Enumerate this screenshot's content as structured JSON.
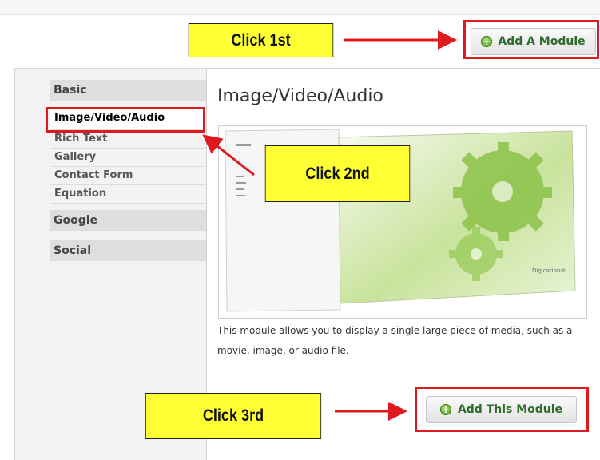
{
  "callouts": {
    "first": "Click 1st",
    "second": "Click 2nd",
    "third": "Click 3rd"
  },
  "header": {
    "add_module_label": "Add A Module",
    "add_module_icon": "plus-circle-icon"
  },
  "sidebar": {
    "categories": [
      {
        "label": "Basic",
        "items": [
          "Image/Video/Audio",
          "Rich Text",
          "Gallery",
          "Contact Form",
          "Equation"
        ]
      },
      {
        "label": "Google"
      },
      {
        "label": "Social"
      }
    ],
    "selected": "Image/Video/Audio"
  },
  "module": {
    "title": "Image/Video/Audio",
    "description": "This module allows you to display a single large piece of media, such as a movie, image, or audio file.",
    "preview_caption": "Digication®",
    "add_label": "Add This Module"
  },
  "colors": {
    "highlight_red": "#e0191e",
    "callout_yellow": "#ffff33",
    "button_text_green": "#2e6b2a"
  }
}
